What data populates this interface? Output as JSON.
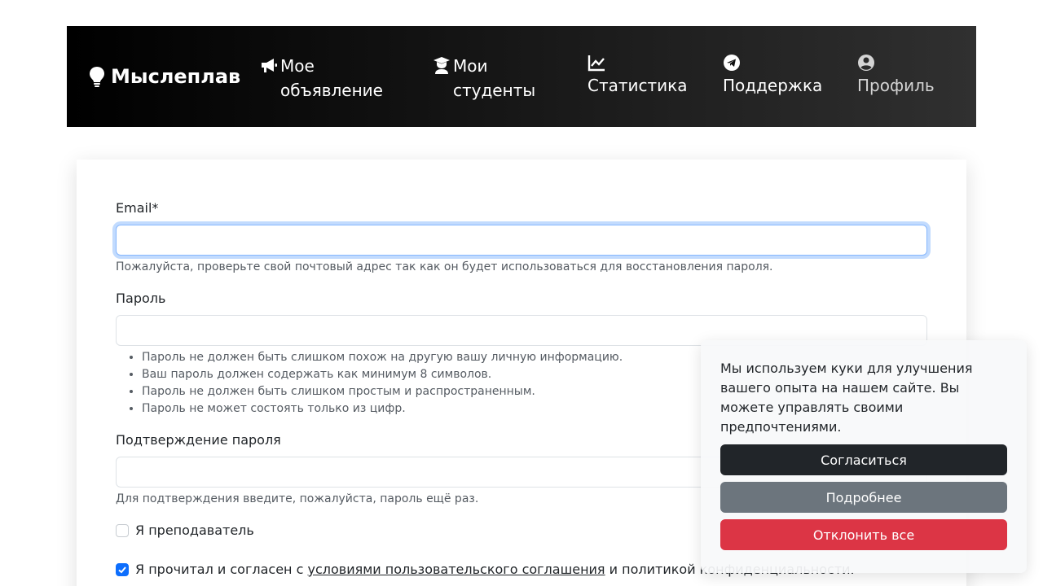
{
  "navbar": {
    "brand": "Мыслеплав",
    "items": [
      {
        "label": "Мое объявление",
        "icon": "megaphone-icon"
      },
      {
        "label": "Мои студенты",
        "icon": "teacher-icon"
      },
      {
        "label": "Статистика",
        "icon": "chart-line-icon"
      },
      {
        "label": "Поддержка",
        "icon": "telegram-icon"
      },
      {
        "label": "Профиль",
        "icon": "user-circle-icon"
      }
    ]
  },
  "form": {
    "email_label": "Email*",
    "email_value": "",
    "email_help": "Пожалуйста, проверьте свой почтовый адрес так как он будет использоваться для восстановления пароля.",
    "password_label": "Пароль",
    "password_value": "",
    "password_rules": [
      "Пароль не должен быть слишком похож на другую вашу личную информацию.",
      "Ваш пароль должен содержать как минимум 8 символов.",
      "Пароль не должен быть слишком простым и распространенным.",
      "Пароль не может состоять только из цифр."
    ],
    "confirm_label": "Подтверждение пароля",
    "confirm_value": "",
    "confirm_help": "Для подтверждения введите, пожалуйста, пароль ещё раз.",
    "teacher_label": "Я преподаватель",
    "teacher_checked": false,
    "agree_prefix": "Я прочитал и согласен с",
    "agree_link": "условиями пользовательского соглашения",
    "agree_suffix": "и политикой конфиденциальности.",
    "agree_checked": true
  },
  "cookie": {
    "text": "Мы используем куки для улучшения вашего опыта на нашем сайте. Вы можете управлять своими предпочтениями.",
    "accept": "Согласиться",
    "more": "Подробнее",
    "decline": "Отклонить все"
  },
  "colors": {
    "primary": "#0d6efd",
    "dark": "#212529",
    "secondary": "#6c757d",
    "danger": "#dc3545"
  }
}
